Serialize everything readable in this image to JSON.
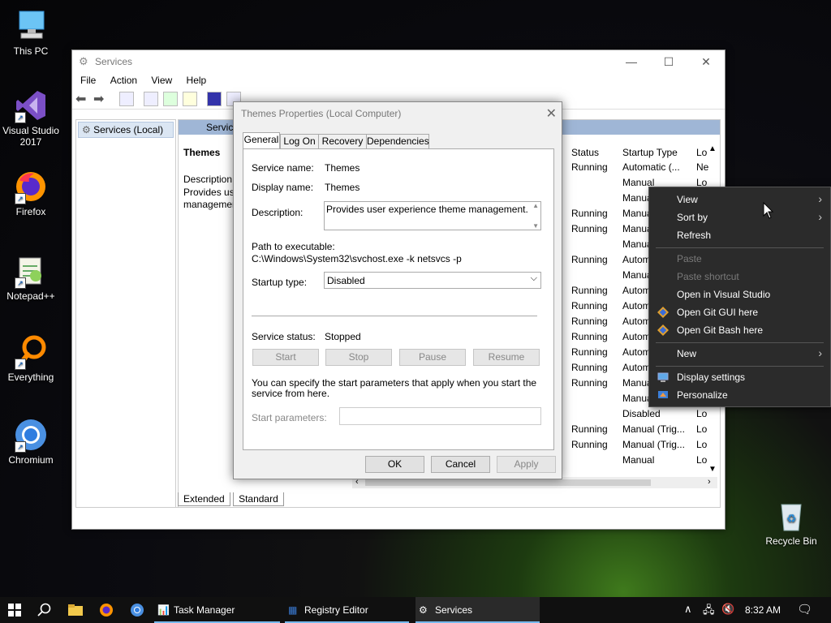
{
  "desktop": {
    "icons": [
      {
        "label": "This PC"
      },
      {
        "label": "Visual Studio 2017"
      },
      {
        "label": "Firefox"
      },
      {
        "label": "Notepad++"
      },
      {
        "label": "Everything"
      },
      {
        "label": "Chromium"
      },
      {
        "label": "Recycle Bin"
      }
    ]
  },
  "services_window": {
    "title": "Services",
    "menu": [
      "File",
      "Action",
      "View",
      "Help"
    ],
    "left_tree_item": "Services (Local)",
    "header_label": "Servic",
    "selected_name": "Themes",
    "desc_lines": [
      "Description:",
      "Provides use",
      "managemen"
    ],
    "columns": {
      "status": "Status",
      "startup": "Startup Type",
      "logon": "Lo"
    },
    "rows": [
      {
        "status": "Running",
        "startup": "Automatic (...",
        "logon": "Ne"
      },
      {
        "status": "",
        "startup": "Manual",
        "logon": "Lo"
      },
      {
        "status": "",
        "startup": "Manual",
        "logon": ""
      },
      {
        "status": "Running",
        "startup": "Manual",
        "logon": ""
      },
      {
        "status": "Running",
        "startup": "Manual",
        "logon": ""
      },
      {
        "status": "",
        "startup": "Manual",
        "logon": ""
      },
      {
        "status": "Running",
        "startup": "Autom",
        "logon": ""
      },
      {
        "status": "",
        "startup": "Manual",
        "logon": ""
      },
      {
        "status": "Running",
        "startup": "Autom",
        "logon": ""
      },
      {
        "status": "Running",
        "startup": "Autom",
        "logon": ""
      },
      {
        "status": "Running",
        "startup": "Autom",
        "logon": ""
      },
      {
        "status": "Running",
        "startup": "Autom",
        "logon": ""
      },
      {
        "status": "Running",
        "startup": "Autom",
        "logon": ""
      },
      {
        "status": "Running",
        "startup": "Autom",
        "logon": ""
      },
      {
        "status": "Running",
        "startup": "Manual",
        "logon": ""
      },
      {
        "status": "",
        "startup": "Manual",
        "logon": ""
      },
      {
        "status": "",
        "startup": "Disabled",
        "logon": "Lo"
      },
      {
        "status": "Running",
        "startup": "Manual (Trig...",
        "logon": "Lo"
      },
      {
        "status": "Running",
        "startup": "Manual (Trig...",
        "logon": "Lo"
      },
      {
        "status": "",
        "startup": "Manual",
        "logon": "Lo"
      }
    ],
    "tabs": [
      "Extended",
      "Standard"
    ]
  },
  "dialog": {
    "title": "Themes Properties (Local Computer)",
    "tabs": [
      "General",
      "Log On",
      "Recovery",
      "Dependencies"
    ],
    "service_name_label": "Service name:",
    "service_name": "Themes",
    "display_name_label": "Display name:",
    "display_name": "Themes",
    "description_label": "Description:",
    "description": "Provides user experience theme management.",
    "path_label": "Path to executable:",
    "path": "C:\\Windows\\System32\\svchost.exe -k netsvcs -p",
    "startup_type_label": "Startup type:",
    "startup_type": "Disabled",
    "service_status_label": "Service status:",
    "service_status": "Stopped",
    "buttons": {
      "start": "Start",
      "stop": "Stop",
      "pause": "Pause",
      "resume": "Resume"
    },
    "hint": "You can specify the start parameters that apply when you start the service from here.",
    "start_params_label": "Start parameters:",
    "ok": "OK",
    "cancel": "Cancel",
    "apply": "Apply"
  },
  "context_menu": {
    "items": [
      {
        "label": "View",
        "submenu": true
      },
      {
        "label": "Sort by",
        "submenu": true
      },
      {
        "label": "Refresh"
      },
      {
        "label": "Paste",
        "disabled": true
      },
      {
        "label": "Paste shortcut",
        "disabled": true
      },
      {
        "label": "Open in Visual Studio"
      },
      {
        "label": "Open Git GUI here"
      },
      {
        "label": "Open Git Bash here"
      },
      {
        "label": "New",
        "submenu": true
      },
      {
        "label": "Display settings"
      },
      {
        "label": "Personalize"
      }
    ]
  },
  "taskbar": {
    "apps": [
      {
        "label": "Task Manager"
      },
      {
        "label": "Registry Editor"
      },
      {
        "label": "Services"
      }
    ],
    "clock": "8:32 AM"
  }
}
